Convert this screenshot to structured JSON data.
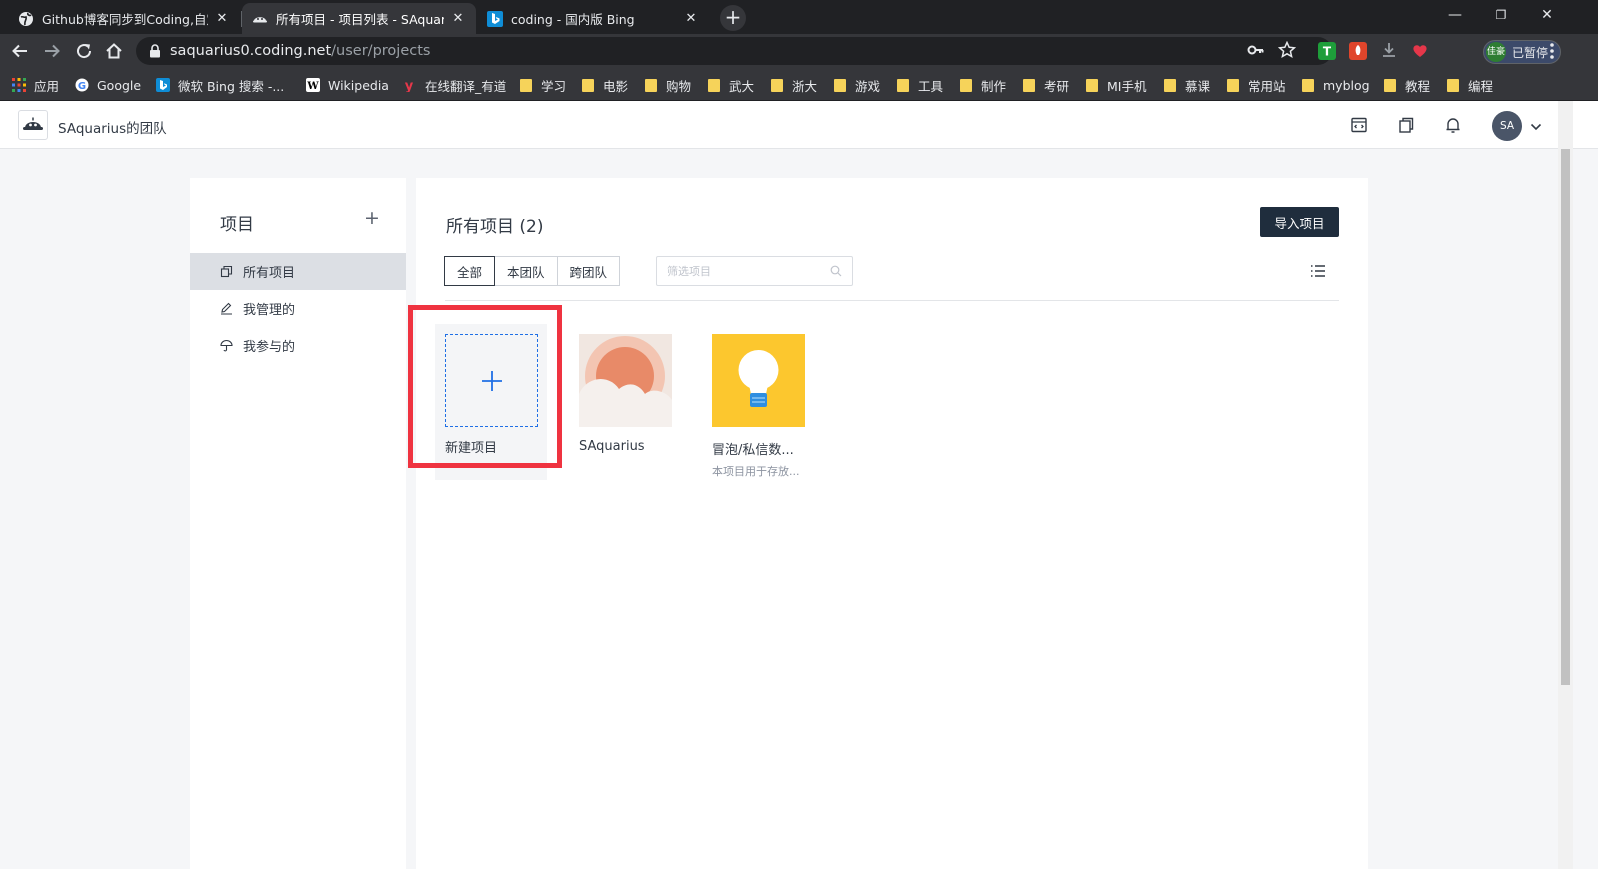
{
  "browser": {
    "tabs": [
      {
        "title": "Github博客同步到Coding,自定义",
        "active": false
      },
      {
        "title": "所有项目 - 项目列表 - SAquarius",
        "active": true
      },
      {
        "title": "coding - 国内版 Bing",
        "active": false
      }
    ],
    "new_tab_label": "+",
    "window_controls": {
      "minimize": "—",
      "restore": "❐",
      "close": "✕"
    },
    "url_host": "saquarius0.coding.net",
    "url_path": "/user/projects",
    "profile_label": "已暂停",
    "profile_avatar": "佳豪",
    "bookmarks": [
      {
        "label": "应用",
        "type": "apps"
      },
      {
        "label": "Google",
        "type": "site"
      },
      {
        "label": "微软 Bing 搜索 -...",
        "type": "site"
      },
      {
        "label": "Wikipedia",
        "type": "site"
      },
      {
        "label": "在线翻译_有道",
        "type": "site"
      },
      {
        "label": "学习",
        "type": "folder"
      },
      {
        "label": "电影",
        "type": "folder"
      },
      {
        "label": "购物",
        "type": "folder"
      },
      {
        "label": "武大",
        "type": "folder"
      },
      {
        "label": "浙大",
        "type": "folder"
      },
      {
        "label": "游戏",
        "type": "folder"
      },
      {
        "label": "工具",
        "type": "folder"
      },
      {
        "label": "制作",
        "type": "folder"
      },
      {
        "label": "考研",
        "type": "folder"
      },
      {
        "label": "MI手机",
        "type": "folder"
      },
      {
        "label": "慕课",
        "type": "folder"
      },
      {
        "label": "常用站",
        "type": "folder"
      },
      {
        "label": "myblog",
        "type": "folder"
      },
      {
        "label": "教程",
        "type": "folder"
      },
      {
        "label": "编程",
        "type": "folder"
      }
    ]
  },
  "header": {
    "team_name": "SAquarius的团队",
    "avatar_initials": "SA"
  },
  "sidebar": {
    "title": "项目",
    "add_label": "+",
    "items": [
      {
        "label": "所有项目",
        "icon": "copy-icon",
        "active": true
      },
      {
        "label": "我管理的",
        "icon": "pencil-icon",
        "active": false
      },
      {
        "label": "我参与的",
        "icon": "umbrella-icon",
        "active": false
      }
    ]
  },
  "main": {
    "title": "所有项目 (2)",
    "import_button": "导入项目",
    "filters": [
      "全部",
      "本团队",
      "跨团队"
    ],
    "active_filter": "全部",
    "search_placeholder": "筛选项目",
    "projects": [
      {
        "name": "新建项目",
        "type": "new"
      },
      {
        "name": "SAquarius",
        "description": "",
        "thumb": "sun-cloud"
      },
      {
        "name": "冒泡/私信数...",
        "description": "本项目用于存放...",
        "thumb": "lightbulb"
      }
    ]
  },
  "colors": {
    "accent_blue": "#1f6fe5",
    "highlight_red": "#ef3340",
    "primary_dark": "#1f2d3d",
    "bulb_yellow": "#fcc72e"
  }
}
